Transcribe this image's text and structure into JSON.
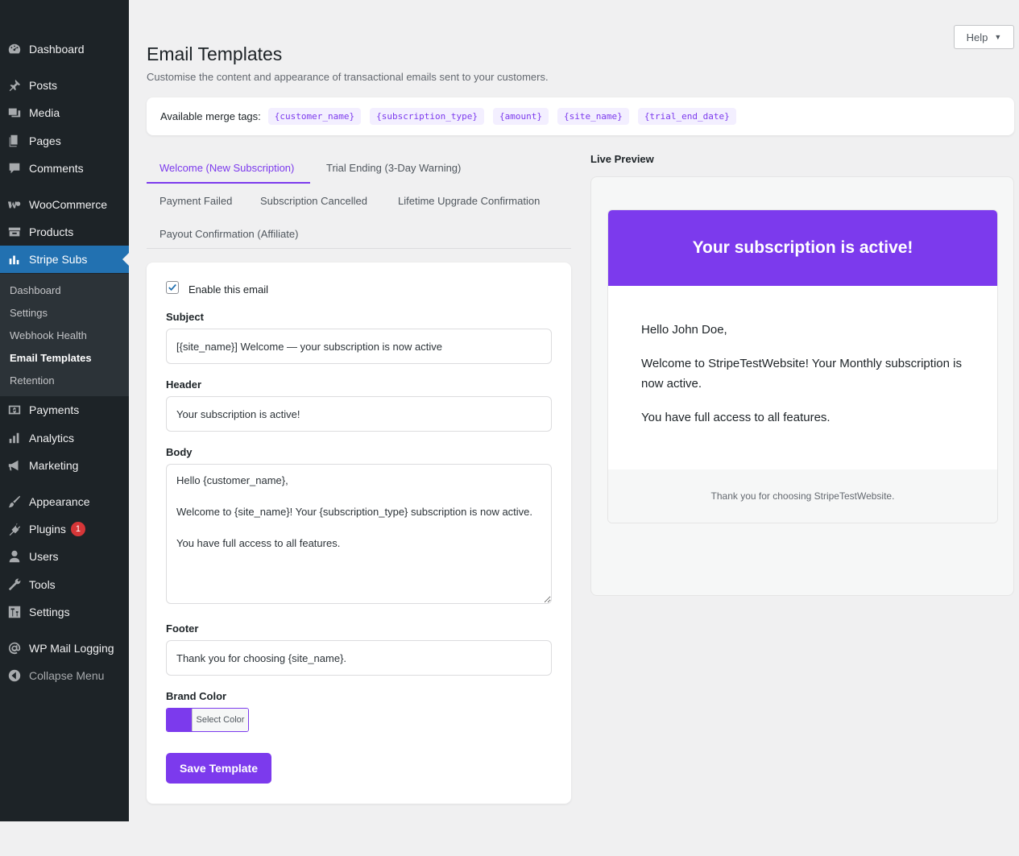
{
  "sidebar": {
    "menu": [
      {
        "label": "Dashboard",
        "icon": "dashboard-icon"
      },
      {
        "label": "Posts",
        "icon": "pin-icon"
      },
      {
        "label": "Media",
        "icon": "media-icon"
      },
      {
        "label": "Pages",
        "icon": "pages-icon"
      },
      {
        "label": "Comments",
        "icon": "comment-icon"
      },
      {
        "label": "WooCommerce",
        "icon": "woocommerce-icon"
      },
      {
        "label": "Products",
        "icon": "archive-icon"
      },
      {
        "label": "Stripe Subs",
        "icon": "chart-bar-icon"
      },
      {
        "label": "Payments",
        "icon": "money-icon"
      },
      {
        "label": "Analytics",
        "icon": "chart-bar-icon"
      },
      {
        "label": "Marketing",
        "icon": "megaphone-icon"
      },
      {
        "label": "Appearance",
        "icon": "brush-icon"
      },
      {
        "label": "Plugins",
        "icon": "plugin-icon",
        "badge": "1"
      },
      {
        "label": "Users",
        "icon": "user-icon"
      },
      {
        "label": "Tools",
        "icon": "wrench-icon"
      },
      {
        "label": "Settings",
        "icon": "settings-icon"
      },
      {
        "label": "WP Mail Logging",
        "icon": "at-icon"
      },
      {
        "label": "Collapse Menu",
        "icon": "collapse-icon"
      }
    ],
    "submenu": [
      "Dashboard",
      "Settings",
      "Webhook Health",
      "Email Templates",
      "Retention"
    ]
  },
  "help_label": "Help",
  "page": {
    "title": "Email Templates",
    "description": "Customise the content and appearance of transactional emails sent to your customers."
  },
  "merge_tags": {
    "label": "Available merge tags:",
    "tags": [
      "{customer_name}",
      "{subscription_type}",
      "{amount}",
      "{site_name}",
      "{trial_end_date}"
    ]
  },
  "tabs": [
    "Welcome (New Subscription)",
    "Trial Ending (3-Day Warning)",
    "Payment Failed",
    "Subscription Cancelled",
    "Lifetime Upgrade Confirmation",
    "Payout Confirmation (Affiliate)"
  ],
  "form": {
    "enable_label": "Enable this email",
    "enabled": true,
    "subject_label": "Subject",
    "subject_value": "[{site_name}] Welcome — your subscription is now active",
    "header_label": "Header",
    "header_value": "Your subscription is active!",
    "body_label": "Body",
    "body_value": "Hello {customer_name},\n\nWelcome to {site_name}! Your {subscription_type} subscription is now active.\n\nYou have full access to all features.",
    "footer_label": "Footer",
    "footer_value": "Thank you for choosing {site_name}.",
    "brand_color_label": "Brand Color",
    "brand_color": "#7c3aed",
    "color_button_label": "Select Color",
    "save_label": "Save Template"
  },
  "preview": {
    "label": "Live Preview",
    "header": "Your subscription is active!",
    "body": [
      "Hello John Doe,",
      "Welcome to StripeTestWebsite! Your Monthly subscription is now active.",
      "You have full access to all features."
    ],
    "footer": "Thank you for choosing StripeTestWebsite."
  }
}
